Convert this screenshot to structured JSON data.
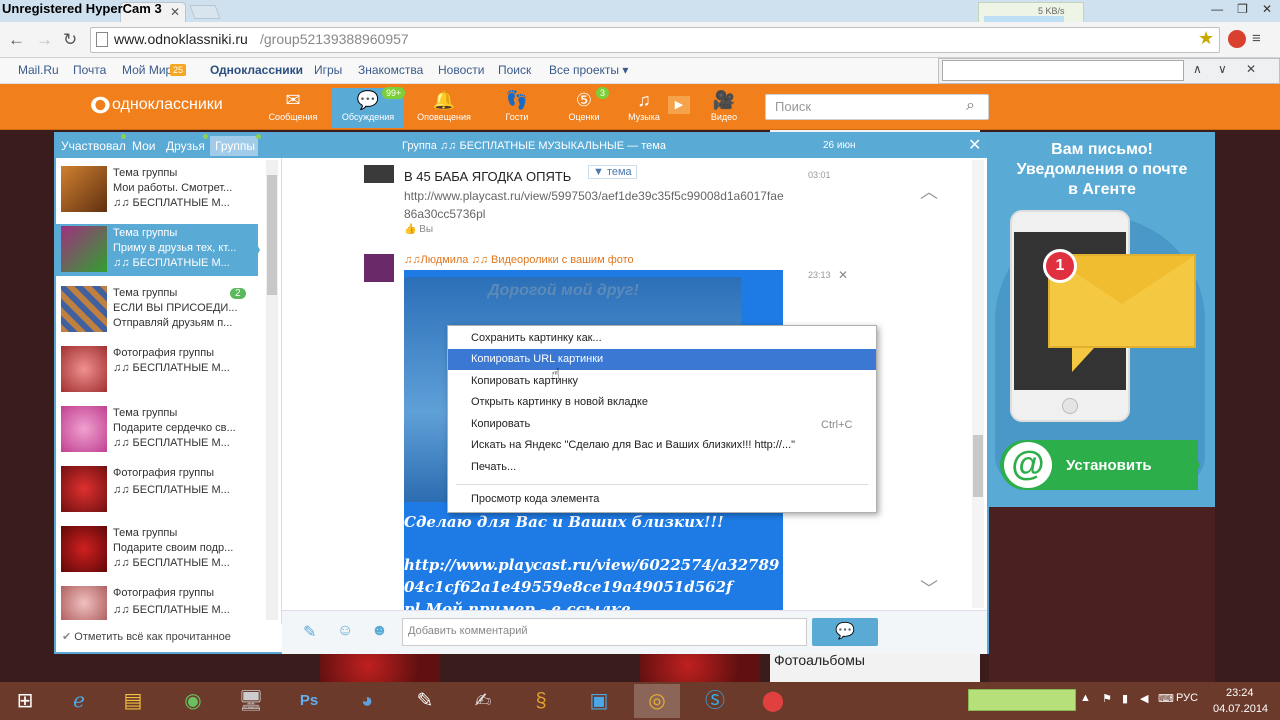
{
  "recorder": {
    "label": "Unregistered HyperCam 3"
  },
  "window": {
    "net_speed": "5 KB/s"
  },
  "browser": {
    "url_host": "www.odnoklassniki.ru",
    "url_path": "/group52139388960957"
  },
  "portal_links": [
    {
      "label": "Mail.Ru"
    },
    {
      "label": "Почта"
    },
    {
      "label": "Мой Мир",
      "badge": "25"
    },
    {
      "label": "Одноклассники"
    },
    {
      "label": "Игры"
    },
    {
      "label": "Знакомства"
    },
    {
      "label": "Новости"
    },
    {
      "label": "Поиск"
    },
    {
      "label": "Все проекты ▾"
    }
  ],
  "ok_toolbar": {
    "logo": "одноклассники",
    "items": [
      {
        "label": "Сообщения",
        "icon": "envelope-icon"
      },
      {
        "label": "Обсуждения",
        "icon": "chat-bubbles-icon",
        "badge": "99+"
      },
      {
        "label": "Оповещения",
        "icon": "bell-icon"
      },
      {
        "label": "Гости",
        "icon": "footprints-icon"
      },
      {
        "label": "Оценки",
        "icon": "star-5-icon",
        "badge": "3"
      },
      {
        "label": "Музыка",
        "icon": "music-note-icon"
      },
      {
        "label": "Видео",
        "icon": "video-camera-icon"
      }
    ],
    "search_placeholder": "Поиск"
  },
  "dialog": {
    "tabs": [
      {
        "label": "Участвовал"
      },
      {
        "label": "Мои"
      },
      {
        "label": "Друзья"
      },
      {
        "label": "Группы"
      }
    ],
    "list": [
      {
        "l1": "Тема группы",
        "l2": "Мои работы. Смотрет...",
        "l3": "♫♫ БЕСПЛАТНЫЕ М..."
      },
      {
        "l1": "Тема группы",
        "l2": "Приму в друзья тех, кт...",
        "l3": "♫♫ БЕСПЛАТНЫЕ М..."
      },
      {
        "l1": "Тема группы",
        "l2": "ЕСЛИ ВЫ ПРИСОЕДИ...",
        "l3": "Отправляй друзьям п...",
        "badge": "2"
      },
      {
        "l1": "Фотография группы",
        "l2": "♫♫ БЕСПЛАТНЫЕ М...",
        "l3": ""
      },
      {
        "l1": "Тема группы",
        "l2": "Подарите сердечко св...",
        "l3": "♫♫ БЕСПЛАТНЫЕ М..."
      },
      {
        "l1": "Фотография группы",
        "l2": "♫♫ БЕСПЛАТНЫЕ М...",
        "l3": ""
      },
      {
        "l1": "Тема группы",
        "l2": "Подарите своим подр...",
        "l3": "♫♫ БЕСПЛАТНЫЕ М..."
      },
      {
        "l1": "Фотография группы",
        "l2": "♫♫ БЕСПЛАТНЫЕ М...",
        "l3": ""
      }
    ],
    "mark_read": "Отметить всё как прочитанное",
    "chat_title": "Группа ♫♫ БЕСПЛАТНЫЕ МУЗЫКАЛЬНЫЕ — тема",
    "chat_date": "26 июн",
    "message1": {
      "head": "В 45 БАБА ЯГОДКА ОПЯТЬ",
      "tag": "▼ тема",
      "time": "03:01",
      "link": "http://www.playcast.ru/view/5997503/aef1de39c35f5c99008d1a6017fae86a30cc5736pl",
      "like": "Вы"
    },
    "message2": {
      "author": "♫♫Людмила ♫♫ Видеоролики с вашим фото",
      "time": "23:13",
      "image_title": "Дорогой мой друг!",
      "image_text1": "Сделаю для Вас и Ваших близких!!!",
      "image_text2": "http://www.playcast.ru/view/6022574/a3278904c1cf62a1e49559e8ce19a49051d562f",
      "image_text3": "pl  Мой пример - в ссылке"
    },
    "comment_placeholder": "Добавить комментарий"
  },
  "context_menu": {
    "items": [
      {
        "label": "Сохранить картинку как..."
      },
      {
        "label": "Копировать URL картинки"
      },
      {
        "label": "Копировать картинку"
      },
      {
        "label": "Открыть картинку в новой вкладке"
      },
      {
        "label": "Копировать",
        "shortcut": "Ctrl+C"
      },
      {
        "label": "Искать на Яндекс \"Сделаю для Вас и Ваших близких!!!   http://...\""
      },
      {
        "label": "Печать..."
      },
      {
        "label": "Просмотр кода элемента"
      }
    ],
    "highlighted_index": 1
  },
  "ad": {
    "title_line1": "Вам письмо!",
    "title_line2": "Уведомления о почте",
    "title_line3": "в Агенте",
    "badge": "1",
    "install_label": "Установить"
  },
  "right_column": {
    "section": "Фотоальбомы"
  },
  "taskbar": {
    "language": "РУС",
    "time": "23:24",
    "date": "04.07.2014"
  },
  "colors": {
    "ok_orange": "#f07f1c",
    "ok_blue": "#5aaad6",
    "menu_highlight": "#3a78d4"
  }
}
